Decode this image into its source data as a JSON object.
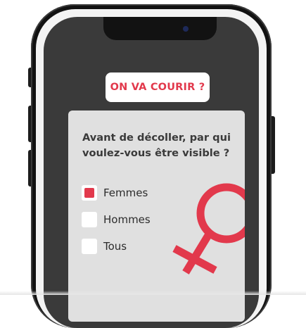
{
  "cta": {
    "label": "ON VA COURIR ?"
  },
  "question": {
    "text": "Avant de décoller, par qui voulez-vous être visible ?"
  },
  "options": [
    {
      "label": "Femmes",
      "checked": true
    },
    {
      "label": "Hommes",
      "checked": false
    },
    {
      "label": "Tous",
      "checked": false
    }
  ],
  "colors": {
    "accent": "#e2394c",
    "screen_background": "#3a3a3a",
    "card_background": "#e0e0e0",
    "phone_frame": "#121212"
  },
  "icons": {
    "decoration": "venus-icon",
    "camera": "front-camera-icon"
  }
}
